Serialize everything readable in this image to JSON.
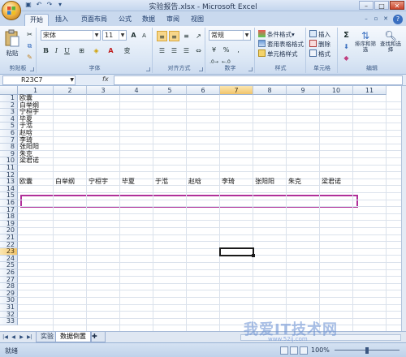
{
  "window": {
    "title": "实验报告.xlsx - Microsoft Excel",
    "qat": [
      "save",
      "undo",
      "redo"
    ]
  },
  "tabs": [
    "开始",
    "插入",
    "页面布局",
    "公式",
    "数据",
    "审阅",
    "视图"
  ],
  "ribbon": {
    "clipboard": {
      "label": "剪贴板",
      "paste": "粘贴"
    },
    "font": {
      "label": "字体",
      "family": "宋体",
      "size": "11",
      "bold": "B",
      "italic": "I",
      "underline": "U",
      "grow": "A",
      "shrink": "A",
      "phonetic": "变"
    },
    "alignment": {
      "label": "对齐方式"
    },
    "number": {
      "label": "数字",
      "format": "常规",
      "percent": "%",
      "comma": ","
    },
    "styles": {
      "label": "样式",
      "conditional": "条件格式",
      "table": "套用表格格式",
      "cell": "单元格样式"
    },
    "cells": {
      "label": "单元格",
      "insert": "插入",
      "delete": "删除",
      "format": "格式"
    },
    "editing": {
      "label": "编辑",
      "sum": "Σ",
      "sort": "排序和筛选",
      "find": "查找和选择"
    }
  },
  "formula_bar": {
    "name_box": "R23C7",
    "fx": "fx",
    "value": ""
  },
  "columns": [
    "1",
    "2",
    "3",
    "4",
    "5",
    "6",
    "7",
    "8",
    "9",
    "10",
    "11"
  ],
  "rows": [
    "1",
    "2",
    "3",
    "4",
    "5",
    "6",
    "7",
    "8",
    "9",
    "10",
    "11",
    "12",
    "13",
    "14",
    "15",
    "16",
    "17",
    "18",
    "19",
    "20",
    "21",
    "22",
    "23",
    "24",
    "25",
    "26",
    "27",
    "28",
    "29",
    "30",
    "31",
    "32",
    "33"
  ],
  "selected": {
    "row": 23,
    "col": 7
  },
  "column_a_names": [
    "欧囊",
    "白举纲",
    "宁桓宇",
    "毕夏",
    "于湉",
    "赵晗",
    "李琦",
    "张阳阳",
    "朱克",
    "梁君诺"
  ],
  "row13_names": [
    "欧囊",
    "白举纲",
    "宁桓宇",
    "毕夏",
    "于湉",
    "赵晗",
    "李琦",
    "张阳阳",
    "朱克",
    "梁君诺"
  ],
  "sheets": [
    {
      "name": "实验",
      "active": false
    },
    {
      "name": "数据倒置",
      "active": true
    }
  ],
  "status": {
    "ready": "就绪",
    "zoom": "100%",
    "zoom_level": 1.0
  },
  "watermark": {
    "main": "我爱IT技术网",
    "sub": "www.52ij.com"
  }
}
